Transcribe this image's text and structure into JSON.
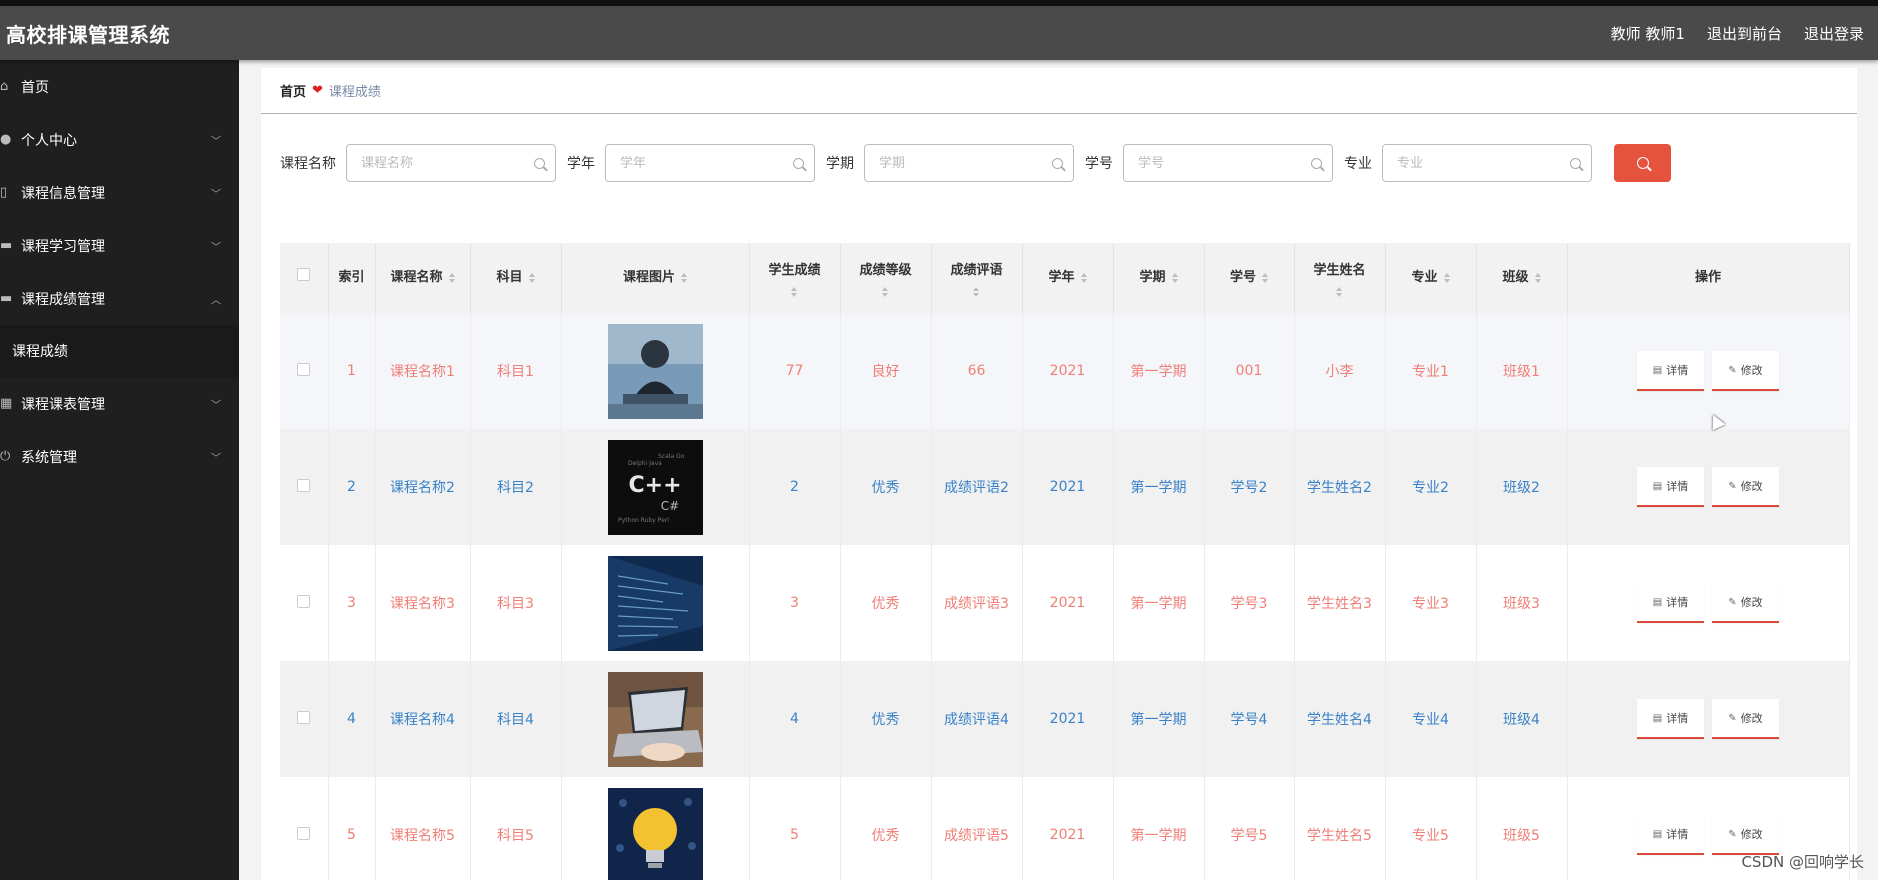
{
  "header": {
    "title": "高校排课管理系统",
    "user": "教师 教师1",
    "to_front": "退出到前台",
    "logout": "退出登录"
  },
  "sidebar": {
    "items": [
      {
        "label": "首页",
        "icon": "home-icon"
      },
      {
        "label": "个人中心",
        "icon": "user-icon"
      },
      {
        "label": "课程信息管理",
        "icon": "doc-icon"
      },
      {
        "label": "课程学习管理",
        "icon": "book-icon"
      },
      {
        "label": "课程成绩管理",
        "icon": "monitor-icon"
      },
      {
        "label": "课程成绩"
      },
      {
        "label": "课程课表管理",
        "icon": "grid-icon"
      },
      {
        "label": "系统管理",
        "icon": "power-icon"
      }
    ]
  },
  "breadcrumb": {
    "home": "首页",
    "current": "课程成绩"
  },
  "search": {
    "course_label": "课程名称",
    "course_placeholder": "课程名称",
    "year_label": "学年",
    "year_placeholder": "学年",
    "term_label": "学期",
    "term_placeholder": "学期",
    "sid_label": "学号",
    "sid_placeholder": "学号",
    "major_label": "专业",
    "major_placeholder": "专业"
  },
  "table": {
    "headers": {
      "index": "索引",
      "course": "课程名称",
      "subject": "科目",
      "image": "课程图片",
      "score": "学生成绩",
      "grade": "成绩等级",
      "comment": "成绩评语",
      "year": "学年",
      "term": "学期",
      "sid": "学号",
      "name": "学生姓名",
      "major": "专业",
      "class": "班级",
      "ops": "操作"
    },
    "detail_label": "详情",
    "edit_label": "修改",
    "rows": [
      {
        "index": "1",
        "course": "课程名称1",
        "subject": "科目1",
        "score": "77",
        "grade": "良好",
        "comment": "66",
        "year": "2021",
        "term": "第一学期",
        "sid": "001",
        "name": "小李",
        "major": "专业1",
        "class": "班级1"
      },
      {
        "index": "2",
        "course": "课程名称2",
        "subject": "科目2",
        "score": "2",
        "grade": "优秀",
        "comment": "成绩评语2",
        "year": "2021",
        "term": "第一学期",
        "sid": "学号2",
        "name": "学生姓名2",
        "major": "专业2",
        "class": "班级2"
      },
      {
        "index": "3",
        "course": "课程名称3",
        "subject": "科目3",
        "score": "3",
        "grade": "优秀",
        "comment": "成绩评语3",
        "year": "2021",
        "term": "第一学期",
        "sid": "学号3",
        "name": "学生姓名3",
        "major": "专业3",
        "class": "班级3"
      },
      {
        "index": "4",
        "course": "课程名称4",
        "subject": "科目4",
        "score": "4",
        "grade": "优秀",
        "comment": "成绩评语4",
        "year": "2021",
        "term": "第一学期",
        "sid": "学号4",
        "name": "学生姓名4",
        "major": "专业4",
        "class": "班级4"
      },
      {
        "index": "5",
        "course": "课程名称5",
        "subject": "科目5",
        "score": "5",
        "grade": "优秀",
        "comment": "成绩评语5",
        "year": "2021",
        "term": "第一学期",
        "sid": "学号5",
        "name": "学生姓名5",
        "major": "专业5",
        "class": "班级5"
      }
    ]
  },
  "watermark": "CSDN @回响学长",
  "colors": {
    "accent": "#e5533f",
    "red_text": "#ef7f76",
    "blue_text": "#3a82c8",
    "sidebar_bg": "#1f1f1f",
    "header_bg": "#4a4a4a"
  }
}
